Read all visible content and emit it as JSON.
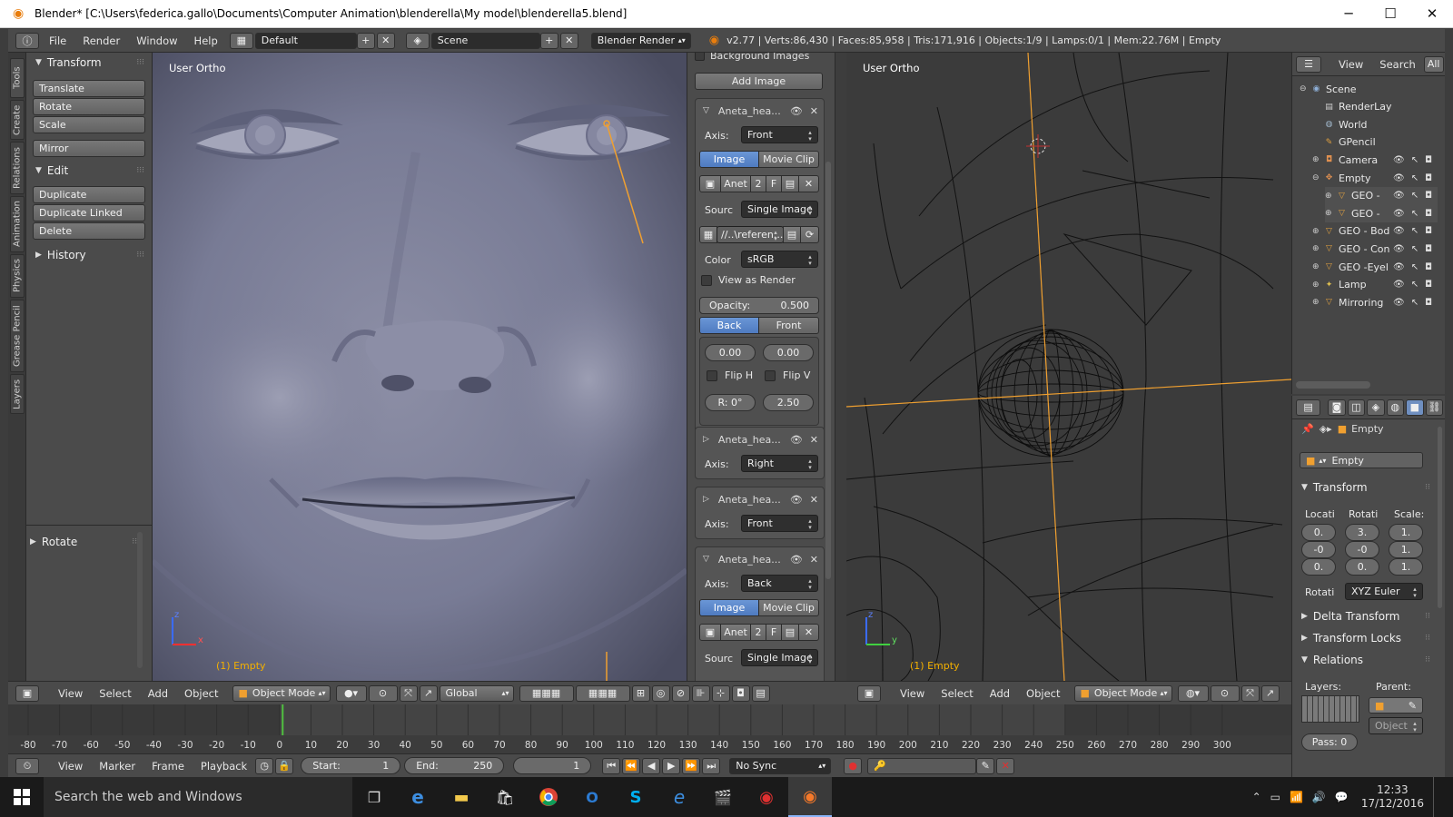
{
  "window": {
    "title": "Blender* [C:\\Users\\federica.gallo\\Documents\\Computer Animation\\blenderella\\My model\\blenderella5.blend]",
    "minimize": "─",
    "maximize": "☐",
    "close": "✕"
  },
  "infobar": {
    "menus": [
      "File",
      "Render",
      "Window",
      "Help"
    ],
    "layout": "Default",
    "scene": "Scene",
    "engine": "Blender Render",
    "stats": "v2.77 | Verts:86,430 | Faces:85,958 | Tris:171,916 | Objects:1/9 | Lamps:0/1 | Mem:22.76M | Empty"
  },
  "tabs": [
    "Tools",
    "Create",
    "Relations",
    "Animation",
    "Physics",
    "Grease Pencil",
    "Layers"
  ],
  "toolshelf": {
    "transform_header": "Transform",
    "transform_buttons": [
      "Translate",
      "Rotate",
      "Scale"
    ],
    "mirror": "Mirror",
    "edit_header": "Edit",
    "edit_buttons": [
      "Duplicate",
      "Duplicate Linked",
      "Delete"
    ],
    "history": "History",
    "last_op": "Rotate"
  },
  "viewport_left": {
    "label": "User Ortho",
    "object": "(1) Empty",
    "axis_z": "z",
    "axis_x": "x",
    "menus": [
      "View",
      "Select",
      "Add",
      "Object"
    ],
    "mode": "Object Mode",
    "orientation": "Global"
  },
  "viewport_right": {
    "label": "User Ortho",
    "object": "(1) Empty",
    "axis_z": "z",
    "axis_y": "y",
    "menus": [
      "View",
      "Select",
      "Add",
      "Object"
    ],
    "mode": "Object Mode"
  },
  "bgimages": {
    "header": "Background Images",
    "add_image": "Add Image",
    "entry1": {
      "name": "Aneta_hea...",
      "axis_label": "Axis:",
      "axis": "Front",
      "tab_image": "Image",
      "tab_movie": "Movie Clip",
      "img_name": "Anet",
      "users": "2",
      "fake": "F",
      "source_label": "Sourc",
      "source": "Single Image",
      "path": "//..\\referen...",
      "color_label": "Color",
      "color": "sRGB",
      "view_as_render": "View as Render",
      "opacity_label": "Opacity:",
      "opacity": "0.500",
      "back": "Back",
      "front": "Front",
      "offset_x": "0.00",
      "offset_y": "0.00",
      "flip_h": "Flip H",
      "flip_v": "Flip V",
      "rotation": "R: 0°",
      "size": "2.50"
    },
    "entry2": {
      "name": "Aneta_hea...",
      "axis_label": "Axis:",
      "axis": "Right"
    },
    "entry3": {
      "name": "Aneta_hea...",
      "axis_label": "Axis:",
      "axis": "Front"
    },
    "entry4": {
      "name": "Aneta_hea...",
      "axis_label": "Axis:",
      "axis": "Back",
      "tab_image": "Image",
      "tab_movie": "Movie Clip",
      "img_name": "Anet",
      "users": "2",
      "fake": "F",
      "source_label": "Sourc",
      "source": "Single Image"
    }
  },
  "outliner": {
    "menus": [
      "View",
      "Search",
      "All"
    ],
    "items": [
      {
        "label": "Scene",
        "color": "#8fb0d8"
      },
      {
        "label": "RenderLay",
        "color": "#cfcfcf"
      },
      {
        "label": "World",
        "color": "#9fb5c8"
      },
      {
        "label": "GPencil",
        "color": "#e0a040"
      },
      {
        "label": "Camera",
        "color": "#e09050"
      },
      {
        "label": "Empty",
        "color": "#e09050"
      },
      {
        "label": "GEO -",
        "color": "#e0a040"
      },
      {
        "label": "GEO -",
        "color": "#e0a040"
      },
      {
        "label": "GEO - Bod",
        "color": "#e0a040"
      },
      {
        "label": "GEO - Con",
        "color": "#e0a040"
      },
      {
        "label": "GEO -Eyel",
        "color": "#e0a040"
      },
      {
        "label": "Lamp",
        "color": "#e0c050"
      },
      {
        "label": "Mirroring",
        "color": "#e0a040"
      }
    ]
  },
  "properties": {
    "breadcrumb": "Empty",
    "object_name": "Empty",
    "transform_header": "Transform",
    "loc_label": "Locati",
    "rot_label": "Rotati",
    "scale_label": "Scale:",
    "loc": [
      "0.",
      "-0",
      "0."
    ],
    "rot": [
      "3.",
      "-0",
      "0."
    ],
    "scale": [
      "1.",
      "1.",
      "1."
    ],
    "rot_mode_label": "Rotati",
    "rot_mode": "XYZ Euler",
    "delta": "Delta Transform",
    "locks": "Transform Locks",
    "relations": "Relations",
    "layers_label": "Layers:",
    "parent_label": "Parent:",
    "parent_type": "Object",
    "pass": "Pass: 0"
  },
  "timeline": {
    "ticks": [
      "-80",
      "-70",
      "-60",
      "-50",
      "-40",
      "-30",
      "-20",
      "-10",
      "0",
      "10",
      "20",
      "30",
      "40",
      "50",
      "60",
      "70",
      "80",
      "90",
      "100",
      "110",
      "120",
      "130",
      "140",
      "150",
      "160",
      "170",
      "180",
      "190",
      "200",
      "210",
      "220",
      "230",
      "240",
      "250",
      "260",
      "270",
      "280",
      "290",
      "300"
    ],
    "current_frame_value": 1,
    "menus": [
      "View",
      "Marker",
      "Frame",
      "Playback"
    ],
    "start": "Start:",
    "start_value": "1",
    "end": "End:",
    "end_value": "250",
    "current": "1",
    "sync": "No Sync"
  },
  "taskbar": {
    "search": "Search the web and Windows",
    "time": "12:33",
    "date": "17/12/2016"
  }
}
